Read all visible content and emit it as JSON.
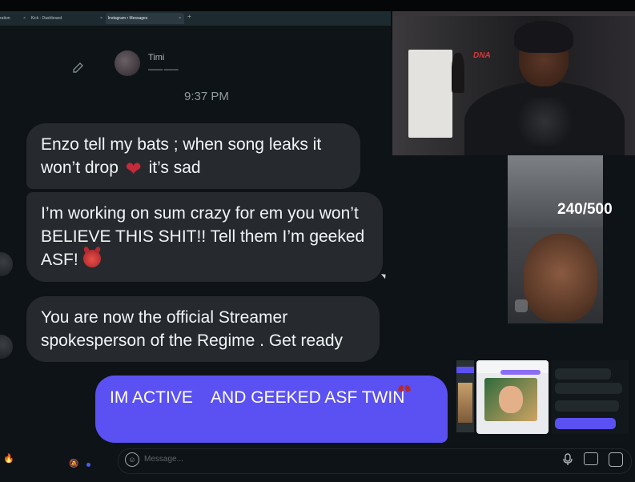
{
  "browser": {
    "tabs": [
      {
        "label": "ration"
      },
      {
        "label": "Kick - Dashboard"
      },
      {
        "label": "Instagram • Messages"
      }
    ],
    "new_tab": "+",
    "tab_close": "×"
  },
  "conversation": {
    "contact_name": "Timi",
    "timestamp": "9:37 PM",
    "messages": [
      {
        "text_a": "Enzo tell my bats ; when song leaks it won’t drop ",
        "text_b": " it’s sad"
      },
      {
        "text_a": "I’m working on sum crazy for em you won’t BELIEVE THIS SHIT!! Tell them I’m geeked ASF! "
      },
      {
        "text_a": "You are now the official Streamer spokesperson of the Regime . Get ready"
      }
    ],
    "sent_message": {
      "part_a": "IM ACTIVE ",
      "part_b": " AND GEEKED ASF TWIN "
    }
  },
  "composer": {
    "placeholder": "Message..."
  },
  "overlay": {
    "counter": "240/500",
    "cam_logo": "DNA"
  },
  "icons": {
    "compose": "compose-icon",
    "broken_heart": "❤",
    "mic": "🎤",
    "emoji": "☺",
    "bell": "🔕",
    "fire": "🔥"
  }
}
